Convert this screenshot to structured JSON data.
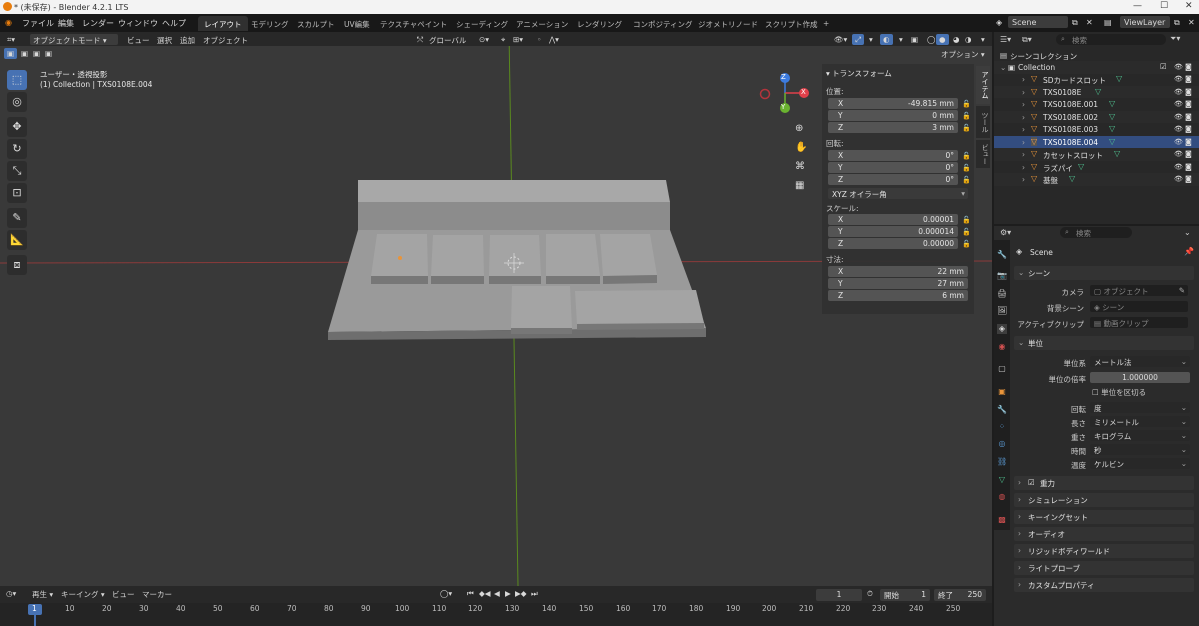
{
  "window": {
    "title": "* (未保存) - Blender 4.2.1 LTS",
    "controls": [
      "—",
      "☐",
      "✕"
    ]
  },
  "menubar": {
    "items": [
      "ファイル",
      "編集",
      "レンダー",
      "ウィンドウ",
      "ヘルプ"
    ],
    "workspaces": [
      "レイアウト",
      "モデリング",
      "スカルプト",
      "UV編集",
      "テクスチャペイント",
      "シェーディング",
      "アニメーション",
      "レンダリング",
      "コンポジティング",
      "ジオメトリノード",
      "スクリプト作成"
    ],
    "active_workspace": "レイアウト",
    "add_tab": "+",
    "scene": "Scene",
    "view_layer": "ViewLayer"
  },
  "viewport": {
    "mode": "オブジェクトモード",
    "menus": [
      "ビュー",
      "選択",
      "追加",
      "オブジェクト"
    ],
    "orientation": "グローバル",
    "options": "オプション",
    "view_name": "ユーザー・透視投影",
    "collection_info": "(1) Collection | TXS0108E.004",
    "gizmo": {
      "x": "X",
      "y": "Y",
      "z": "Z"
    }
  },
  "npanel": {
    "title": "トランスフォーム",
    "location_label": "位置:",
    "location": [
      {
        "axis": "X",
        "value": "-49.815 mm"
      },
      {
        "axis": "Y",
        "value": "0 mm"
      },
      {
        "axis": "Z",
        "value": "3 mm"
      }
    ],
    "rotation_label": "回転:",
    "rotation": [
      {
        "axis": "X",
        "value": "0°"
      },
      {
        "axis": "Y",
        "value": "0°"
      },
      {
        "axis": "Z",
        "value": "0°"
      }
    ],
    "rotation_mode": "XYZ オイラー角",
    "scale_label": "スケール:",
    "scale": [
      {
        "axis": "X",
        "value": "0.00001"
      },
      {
        "axis": "Y",
        "value": "0.000014"
      },
      {
        "axis": "Z",
        "value": "0.00000"
      }
    ],
    "dimensions_label": "寸法:",
    "dimensions": [
      {
        "axis": "X",
        "value": "22 mm"
      },
      {
        "axis": "Y",
        "value": "27 mm"
      },
      {
        "axis": "Z",
        "value": "6 mm"
      }
    ],
    "tabs": [
      "アイテム",
      "ツール",
      "ビュー"
    ]
  },
  "outliner": {
    "search_placeholder": "検索",
    "root": "シーンコレクション",
    "collection": "Collection",
    "items": [
      "SDカードスロット",
      "TXS0108E",
      "TXS0108E.001",
      "TXS0108E.002",
      "TXS0108E.003",
      "TXS0108E.004",
      "カセットスロット",
      "ラズパイ",
      "基盤"
    ],
    "selected_index": 5
  },
  "properties": {
    "search_placeholder": "検索",
    "scene_name": "Scene",
    "scene_section": "シーン",
    "camera_label": "カメラ",
    "camera_value": "オブジェクト",
    "background_label": "背景シーン",
    "background_value": "シーン",
    "clip_label": "アクティブクリップ",
    "clip_value": "動画クリップ",
    "units_section": "単位",
    "unit_system_label": "単位系",
    "unit_system": "メートル法",
    "unit_scale_label": "単位の倍率",
    "unit_scale": "1.000000",
    "separate_units": "単位を区切る",
    "rotation_label": "回転",
    "rotation_value": "度",
    "length_label": "長さ",
    "length_value": "ミリメートル",
    "mass_label": "重さ",
    "mass_value": "キログラム",
    "time_label": "時間",
    "time_value": "秒",
    "temperature_label": "温度",
    "temperature_value": "ケルビン",
    "collapsed_sections": [
      "重力",
      "シミュレーション",
      "キーイングセット",
      "オーディオ",
      "リジッドボディワールド",
      "ライトプローブ",
      "カスタムプロパティ"
    ]
  },
  "timeline": {
    "menus": [
      "再生",
      "キーイング",
      "ビュー",
      "マーカー"
    ],
    "current_frame": "1",
    "start_label": "開始",
    "start": "1",
    "end_label": "終了",
    "end": "250",
    "ticks": [
      "1",
      "10",
      "20",
      "30",
      "40",
      "50",
      "60",
      "70",
      "80",
      "90",
      "100",
      "110",
      "120",
      "130",
      "140",
      "150",
      "160",
      "170",
      "180",
      "190",
      "200",
      "210",
      "220",
      "230",
      "240",
      "250"
    ]
  }
}
